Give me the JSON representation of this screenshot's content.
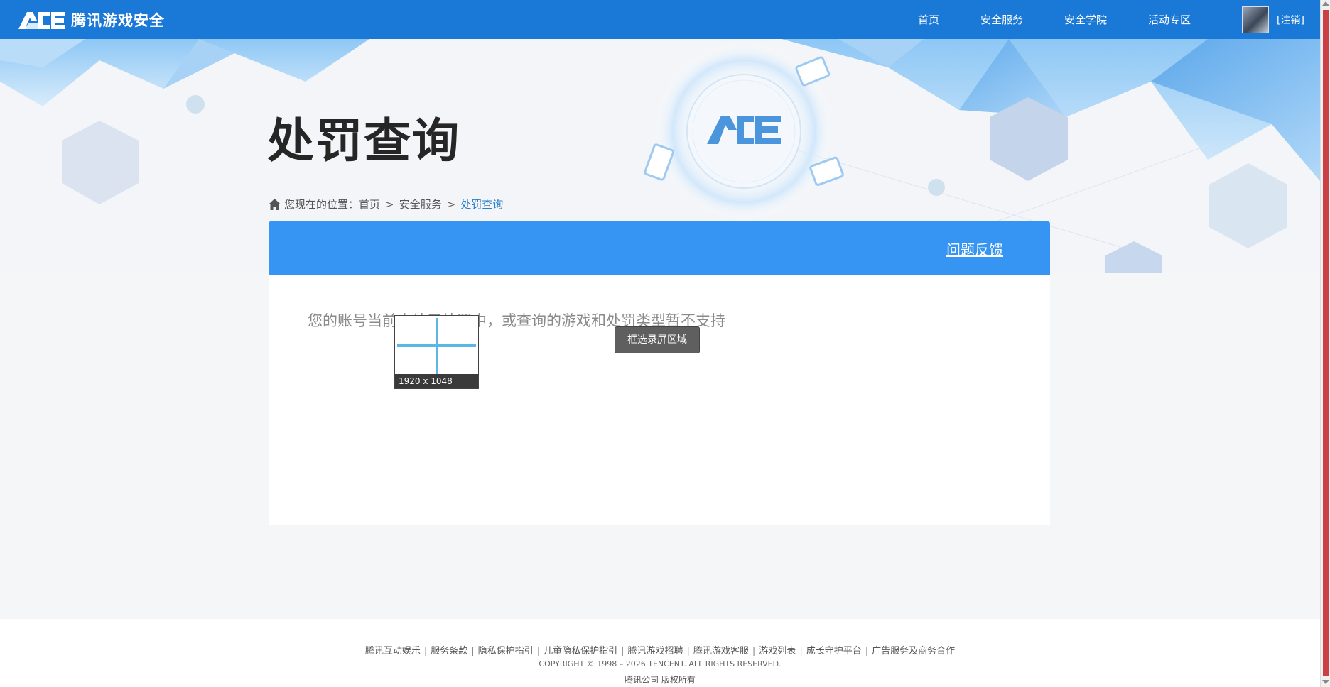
{
  "header": {
    "brand": "腾讯游戏安全",
    "nav": [
      "首页",
      "安全服务",
      "安全学院",
      "活动专区"
    ],
    "logout": "[注销]"
  },
  "page": {
    "title": "处罚查询",
    "breadcrumb": {
      "prefix": "您现在的位置：",
      "items": [
        "首页",
        "安全服务"
      ],
      "current": "处罚查询",
      "separator": ">"
    }
  },
  "card": {
    "feedback": "问题反馈",
    "message": "您的账号当前未处于处罚中，或查询的游戏和处罚类型暂不支持"
  },
  "capture_overlay": {
    "size_label": "1920 x 1048",
    "tooltip": "框选录屏区域"
  },
  "footer": {
    "links": [
      "腾讯互动娱乐",
      "服务条款",
      "隐私保护指引",
      "儿童隐私保护指引",
      "腾讯游戏招聘",
      "腾讯游戏客服",
      "游戏列表",
      "成长守护平台",
      "广告服务及商务合作"
    ],
    "copyright": "COPYRIGHT © 1998 – 2026 TENCENT. ALL RIGHTS RESERVED.",
    "rights": "腾讯公司 版权所有"
  },
  "colors": {
    "topbar": "#1a78d6",
    "card_header": "#3694f2",
    "breadcrumb_current": "#2a7ec9"
  }
}
